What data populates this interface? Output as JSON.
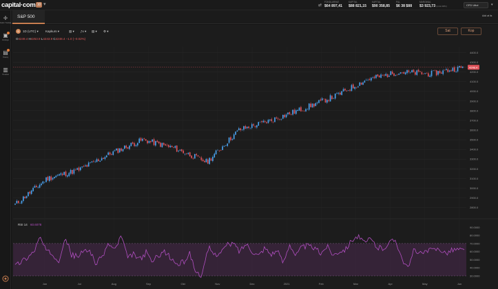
{
  "brand": {
    "logo_text": "capital·com",
    "badge": "10"
  },
  "header": {
    "stats": [
      {
        "label": "Fondlarınız",
        "value": "$64 897,41"
      },
      {
        "label": "Kapital",
        "value": "$88 821,15"
      },
      {
        "label": "Kapital",
        "value": "$90 358,85"
      },
      {
        "label": "P&L",
        "value": "$6 38 $88"
      },
      {
        "label": "Marginal",
        "value": "$3 923,73"
      }
    ],
    "margin_extra": "(Limit 48%)",
    "account_selector": "CFD Utlol"
  },
  "tabs": {
    "active": "S&P 500",
    "add_label": "Add at lis"
  },
  "sidebar": [
    {
      "icon": "crosshair-icon",
      "glyph": "✛",
      "label": "Faktiv Tradıqlar"
    },
    {
      "icon": "chart-window-icon",
      "glyph": "▣",
      "label": "Portfolyo"
    },
    {
      "icon": "wallet-icon",
      "glyph": "▤",
      "label": "Ödəniş"
    },
    {
      "icon": "document-icon",
      "glyph": "▥",
      "label": "Hesabat"
    }
  ],
  "chart": {
    "toolbar": {
      "interval": "1D (UTC)",
      "price_type": "Kapkurs",
      "chart_type": "▥ ▾",
      "indicators": "ƒx ▾",
      "drawing": "▤ ▾",
      "settings": "⚙ ▾"
    },
    "ohlc": {
      "o": "4249.4",
      "h": "4253.9",
      "l": "4243.9",
      "c": "4248.4",
      "change": "−1.0 (−0.02%)"
    },
    "sell_label": "Sat",
    "buy_label": "Kop",
    "current_price_tag": "4248.4",
    "rsi": {
      "name": "RSI 14",
      "value": "60.6078"
    },
    "nav_buttons": [
      "◀",
      "▶",
      "⊖",
      "⊕",
      "⟲",
      "▸"
    ]
  },
  "chart_data": [
    {
      "type": "candlestick",
      "title": "S&P 500",
      "x": [
        "2020-05-13",
        "2020-06",
        "2020-07",
        "2020-08",
        "2020-09",
        "2020-10",
        "2020-11",
        "2020-12",
        "2021-01",
        "2021-02",
        "2021-03",
        "2021-04",
        "2021-05",
        "2021-06",
        "2021-06-09"
      ],
      "close": [
        2830,
        3100,
        3190,
        3360,
        3500,
        3410,
        3270,
        3600,
        3700,
        3820,
        3950,
        4120,
        4200,
        4180,
        4248
      ],
      "x_tick_labels": [
        "Jun",
        "Jul",
        "Aug",
        "Sep",
        "Okt",
        "Nov",
        "Dec",
        "2021",
        "Feb",
        "Mar",
        "Apr",
        "May",
        "Jun"
      ],
      "y_tick_labels": [
        "4400.0",
        "4300.0",
        "4200.0",
        "4100.0",
        "4000.0",
        "3900.0",
        "3800.0",
        "3700.0",
        "3600.0",
        "3500.0",
        "3400.0",
        "3300.0",
        "3200.0",
        "3100.0",
        "3000.0",
        "2900.0",
        "2800.0"
      ],
      "ylim": [
        2740,
        4460
      ],
      "up_color": "#4aa3f0",
      "down_color": "#e0535a",
      "grid": true
    },
    {
      "type": "line",
      "title": "RSI 14",
      "values": [
        42,
        48,
        53,
        60,
        78,
        60,
        57,
        49,
        79,
        56,
        54,
        60,
        62,
        44,
        55,
        70,
        62,
        80,
        52,
        57,
        50,
        59,
        47,
        56,
        60,
        51,
        44,
        47,
        58,
        34,
        31,
        65,
        56,
        60,
        68,
        70,
        60,
        70,
        61,
        55,
        65,
        57,
        61,
        46,
        70,
        55,
        66,
        67,
        64,
        58,
        67,
        56,
        61,
        63,
        75,
        79,
        70,
        76,
        65,
        64,
        71,
        75,
        52,
        38,
        64,
        57,
        60,
        62,
        64,
        58,
        62,
        63,
        61
      ],
      "y_tick_labels": [
        "90.0000",
        "80.0000",
        "70.0000",
        "60.0000",
        "50.0000",
        "40.0000",
        "30.0000"
      ],
      "ylim": [
        24,
        92
      ],
      "bands": [
        30,
        70
      ],
      "line_color": "#b24fc2",
      "band_color": "#4a2a4f"
    }
  ]
}
